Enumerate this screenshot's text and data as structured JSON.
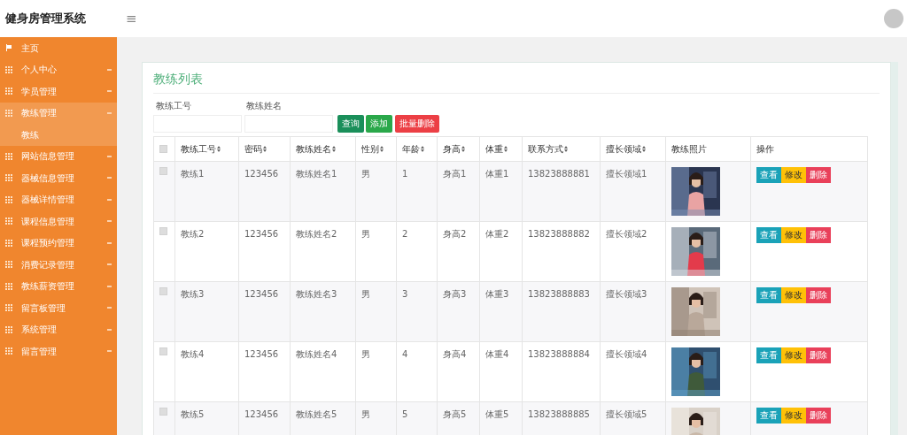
{
  "app_title": "健身房管理系统",
  "menu_toggle": "≡",
  "sidebar": {
    "items": [
      {
        "label": "主页",
        "kind": "home",
        "expanded": false
      },
      {
        "label": "个人中心",
        "kind": "menu",
        "expanded": false
      },
      {
        "label": "学员管理",
        "kind": "menu",
        "expanded": false
      },
      {
        "label": "教练管理",
        "kind": "menu",
        "expanded": true,
        "children": [
          {
            "label": "教练"
          }
        ]
      },
      {
        "label": "网站信息管理",
        "kind": "menu",
        "expanded": false
      },
      {
        "label": "器械信息管理",
        "kind": "menu",
        "expanded": false
      },
      {
        "label": "器械详情管理",
        "kind": "menu",
        "expanded": false
      },
      {
        "label": "课程信息管理",
        "kind": "menu",
        "expanded": false
      },
      {
        "label": "课程预约管理",
        "kind": "menu",
        "expanded": false
      },
      {
        "label": "消费记录管理",
        "kind": "menu",
        "expanded": false
      },
      {
        "label": "教练薪资管理",
        "kind": "menu",
        "expanded": false
      },
      {
        "label": "留言板管理",
        "kind": "menu",
        "expanded": false
      },
      {
        "label": "系统管理",
        "kind": "menu",
        "expanded": false
      },
      {
        "label": "留言管理",
        "kind": "menu",
        "expanded": false
      }
    ]
  },
  "card_title": "教练列表",
  "filters": [
    {
      "label": "教练工号"
    },
    {
      "label": "教练姓名"
    }
  ],
  "buttons": [
    {
      "label": "查询",
      "kind": "search"
    },
    {
      "label": "添加",
      "kind": "add"
    },
    {
      "label": "批量删除",
      "kind": "delete"
    }
  ],
  "table": {
    "columns": [
      {
        "label": "教练工号",
        "sortable": true
      },
      {
        "label": "密码",
        "sortable": true
      },
      {
        "label": "教练姓名",
        "sortable": true
      },
      {
        "label": "性别",
        "sortable": true
      },
      {
        "label": "年龄",
        "sortable": true
      },
      {
        "label": "身高",
        "sortable": true
      },
      {
        "label": "体重",
        "sortable": true
      },
      {
        "label": "联系方式",
        "sortable": true
      },
      {
        "label": "擅长领域",
        "sortable": true
      },
      {
        "label": "教练照片",
        "sortable": false
      },
      {
        "label": "操作",
        "sortable": false
      }
    ],
    "header_checked": false,
    "rows": [
      {
        "checked": false,
        "cells": [
          "教练1",
          "123456",
          "教练姓名1",
          "男",
          "1",
          "身高1",
          "体重1",
          "13823888881",
          "擅长领域1"
        ],
        "actions": [
          {
            "label": "查看",
            "kind": "view"
          },
          {
            "label": "修改",
            "kind": "edit"
          },
          {
            "label": "删除",
            "kind": "delete"
          }
        ]
      },
      {
        "checked": false,
        "cells": [
          "教练2",
          "123456",
          "教练姓名2",
          "男",
          "2",
          "身高2",
          "体重2",
          "13823888882",
          "擅长领域2"
        ],
        "actions": [
          {
            "label": "查看",
            "kind": "view"
          },
          {
            "label": "修改",
            "kind": "edit"
          },
          {
            "label": "删除",
            "kind": "delete"
          }
        ]
      },
      {
        "checked": false,
        "cells": [
          "教练3",
          "123456",
          "教练姓名3",
          "男",
          "3",
          "身高3",
          "体重3",
          "13823888883",
          "擅长领域3"
        ],
        "actions": [
          {
            "label": "查看",
            "kind": "view"
          },
          {
            "label": "修改",
            "kind": "edit"
          },
          {
            "label": "删除",
            "kind": "delete"
          }
        ]
      },
      {
        "checked": false,
        "cells": [
          "教练4",
          "123456",
          "教练姓名4",
          "男",
          "4",
          "身高4",
          "体重4",
          "13823888884",
          "擅长领域4"
        ],
        "actions": [
          {
            "label": "查看",
            "kind": "view"
          },
          {
            "label": "修改",
            "kind": "edit"
          },
          {
            "label": "删除",
            "kind": "delete"
          }
        ]
      },
      {
        "checked": false,
        "cells": [
          "教练5",
          "123456",
          "教练姓名5",
          "男",
          "5",
          "身高5",
          "体重5",
          "13823888885",
          "擅长领域5"
        ],
        "actions": [
          {
            "label": "查看",
            "kind": "view"
          },
          {
            "label": "修改",
            "kind": "edit"
          },
          {
            "label": "删除",
            "kind": "delete"
          }
        ]
      }
    ]
  }
}
